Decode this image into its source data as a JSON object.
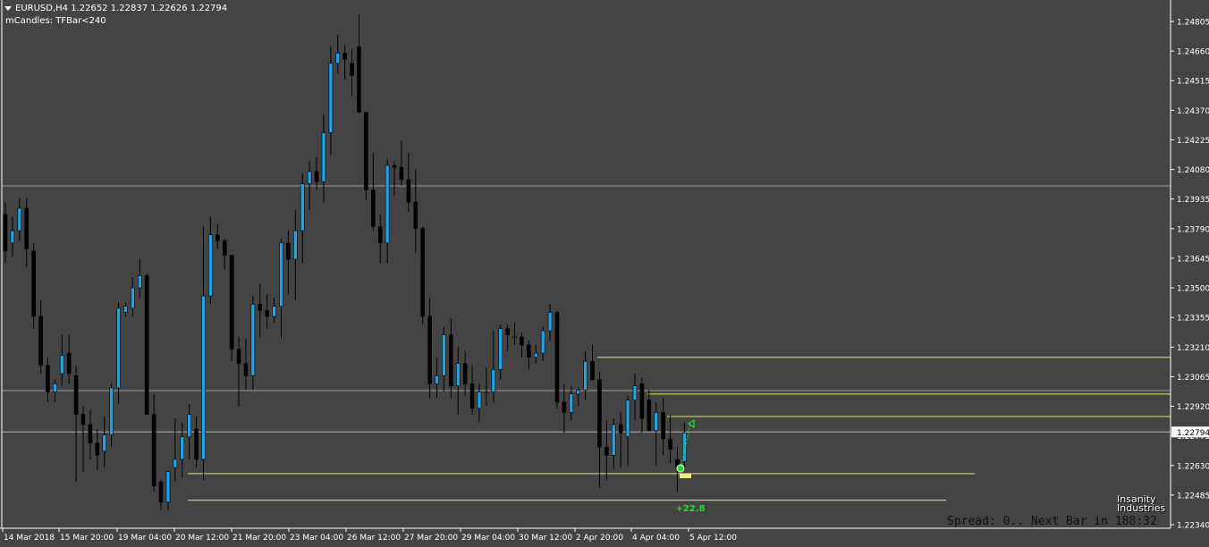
{
  "header": {
    "symbol_line": "EURUSD,H4  1.22652 1.22837 1.22626 1.22794",
    "indicator_line": "mCandles: TFBar<240"
  },
  "price_axis": {
    "labels": [
      "1.24805",
      "1.24660",
      "1.24515",
      "1.24370",
      "1.24225",
      "1.24080",
      "1.23935",
      "1.23790",
      "1.23645",
      "1.23500",
      "1.23355",
      "1.23210",
      "1.23065",
      "1.22920",
      "1.22775",
      "1.22630",
      "1.22485",
      "1.22340"
    ],
    "current_price": "1.22794"
  },
  "time_axis": {
    "labels": [
      "14 Mar 2018",
      "15 Mar 20:00",
      "19 Mar 04:00",
      "20 Mar 12:00",
      "21 Mar 20:00",
      "23 Mar 04:00",
      "26 Mar 12:00",
      "27 Mar 20:00",
      "29 Mar 04:00",
      "30 Mar 12:00",
      "2 Apr 20:00",
      "4 Apr 04:00",
      "5 Apr 12:00"
    ]
  },
  "annotation": {
    "pips": "+22.8"
  },
  "status": {
    "text": "Spread: 0.. Next Bar in 188:32"
  },
  "logo": {
    "line1": "Insanity",
    "line2": "Industries"
  },
  "colors": {
    "background": "#444444",
    "bull": "#1fa2e6",
    "bear": "#000000",
    "level_line": "#e8e85a",
    "grid_line": "#9a9a9a",
    "axis_text": "#ffffff",
    "pips_text": "#22dd22"
  },
  "chart_data": {
    "type": "candlestick",
    "symbol": "EURUSD",
    "timeframe": "H4",
    "ylim": [
      1.2231,
      1.2494
    ],
    "candles": [
      [
        1.2386,
        1.2392,
        1.2362,
        1.2368
      ],
      [
        1.2372,
        1.2385,
        1.2365,
        1.2378
      ],
      [
        1.2378,
        1.2394,
        1.2373,
        1.2389
      ],
      [
        1.2389,
        1.2394,
        1.236,
        1.2369
      ],
      [
        1.2368,
        1.2372,
        1.233,
        1.2336
      ],
      [
        1.2336,
        1.2344,
        1.2308,
        1.2312
      ],
      [
        1.2312,
        1.2316,
        1.2294,
        1.2299
      ],
      [
        1.2299,
        1.2305,
        1.2294,
        1.2303
      ],
      [
        1.2308,
        1.2327,
        1.2302,
        1.2317
      ],
      [
        1.2318,
        1.2327,
        1.2303,
        1.2308
      ],
      [
        1.2307,
        1.2312,
        1.2255,
        1.2288
      ],
      [
        1.2288,
        1.2292,
        1.226,
        1.2283
      ],
      [
        1.2283,
        1.229,
        1.2266,
        1.2274
      ],
      [
        1.2274,
        1.2281,
        1.2261,
        1.2268
      ],
      [
        1.227,
        1.2287,
        1.2262,
        1.2278
      ],
      [
        1.2278,
        1.2303,
        1.2272,
        1.2301
      ],
      [
        1.2301,
        1.2343,
        1.2293,
        1.234
      ],
      [
        1.2338,
        1.2343,
        1.2336,
        1.2341
      ],
      [
        1.234,
        1.2355,
        1.2336,
        1.235
      ],
      [
        1.235,
        1.2364,
        1.2345,
        1.2356
      ],
      [
        1.2356,
        1.2357,
        1.2289,
        1.2288
      ],
      [
        1.2288,
        1.2298,
        1.225,
        1.2253
      ],
      [
        1.2255,
        1.2256,
        1.2241,
        1.2245
      ],
      [
        1.2245,
        1.226,
        1.2241,
        1.226
      ],
      [
        1.2262,
        1.2286,
        1.2255,
        1.2266
      ],
      [
        1.2266,
        1.2284,
        1.2257,
        1.2277
      ],
      [
        1.2277,
        1.2293,
        1.2266,
        1.2288
      ],
      [
        1.2281,
        1.2287,
        1.2262,
        1.2266
      ],
      [
        1.2266,
        1.238,
        1.2256,
        1.2346
      ],
      [
        1.2346,
        1.2385,
        1.2342,
        1.2376
      ],
      [
        1.2376,
        1.2381,
        1.2369,
        1.2373
      ],
      [
        1.2373,
        1.2374,
        1.2359,
        1.2366
      ],
      [
        1.2366,
        1.2366,
        1.2314,
        1.232
      ],
      [
        1.232,
        1.2326,
        1.2292,
        1.2313
      ],
      [
        1.2313,
        1.2325,
        1.23,
        1.2307
      ],
      [
        1.2307,
        1.2346,
        1.23,
        1.2342
      ],
      [
        1.2342,
        1.2352,
        1.2326,
        1.2339
      ],
      [
        1.2339,
        1.2347,
        1.233,
        1.2336
      ],
      [
        1.2336,
        1.2345,
        1.2333,
        1.2341
      ],
      [
        1.2341,
        1.2374,
        1.2325,
        1.2372
      ],
      [
        1.2372,
        1.2378,
        1.2347,
        1.2364
      ],
      [
        1.2364,
        1.2388,
        1.2344,
        1.2378
      ],
      [
        1.2378,
        1.2406,
        1.2362,
        1.2401
      ],
      [
        1.2401,
        1.2412,
        1.2388,
        1.2407
      ],
      [
        1.2407,
        1.2414,
        1.2398,
        1.2402
      ],
      [
        1.2402,
        1.2435,
        1.2392,
        1.2426
      ],
      [
        1.2426,
        1.2468,
        1.2415,
        1.246
      ],
      [
        1.246,
        1.2474,
        1.2455,
        1.2465
      ],
      [
        1.2465,
        1.2469,
        1.2452,
        1.2462
      ],
      [
        1.246,
        1.2467,
        1.2444,
        1.2454
      ],
      [
        1.2468,
        1.2484,
        1.2436,
        1.2436
      ],
      [
        1.2436,
        1.2436,
        1.2393,
        1.2398
      ],
      [
        1.2398,
        1.2416,
        1.2378,
        1.238
      ],
      [
        1.238,
        1.2386,
        1.2362,
        1.2372
      ],
      [
        1.2372,
        1.2413,
        1.2362,
        1.241
      ],
      [
        1.241,
        1.2412,
        1.2395,
        1.2409
      ],
      [
        1.2409,
        1.2422,
        1.24,
        1.2403
      ],
      [
        1.2403,
        1.2416,
        1.2387,
        1.2392
      ],
      [
        1.2392,
        1.2408,
        1.2367,
        1.2379
      ],
      [
        1.2379,
        1.238,
        1.2332,
        1.2336
      ],
      [
        1.2336,
        1.2345,
        1.2296,
        1.2303
      ],
      [
        1.2303,
        1.2316,
        1.2296,
        1.2307
      ],
      [
        1.2307,
        1.2331,
        1.2299,
        1.2327
      ],
      [
        1.2327,
        1.2335,
        1.2296,
        1.2302
      ],
      [
        1.2302,
        1.2321,
        1.2288,
        1.2313
      ],
      [
        1.2313,
        1.2319,
        1.2297,
        1.2303
      ],
      [
        1.2303,
        1.2312,
        1.2288,
        1.2291
      ],
      [
        1.2291,
        1.2303,
        1.2284,
        1.2299
      ],
      [
        1.2299,
        1.2311,
        1.2292,
        1.2299
      ],
      [
        1.2299,
        1.2329,
        1.2294,
        1.231
      ],
      [
        1.231,
        1.2332,
        1.2305,
        1.233
      ],
      [
        1.233,
        1.2332,
        1.2319,
        1.2327
      ],
      [
        1.2326,
        1.2333,
        1.2322,
        1.2326
      ],
      [
        1.2326,
        1.2328,
        1.2316,
        1.2322
      ],
      [
        1.2322,
        1.2324,
        1.231,
        1.2316
      ],
      [
        1.2316,
        1.2322,
        1.2313,
        1.2318
      ],
      [
        1.2318,
        1.2331,
        1.2314,
        1.2329
      ],
      [
        1.2329,
        1.2342,
        1.2324,
        1.2338
      ],
      [
        1.2338,
        1.2339,
        1.2291,
        1.2294
      ],
      [
        1.2294,
        1.2303,
        1.2279,
        1.2289
      ],
      [
        1.2289,
        1.2302,
        1.2285,
        1.2298
      ],
      [
        1.2298,
        1.2301,
        1.2292,
        1.23
      ],
      [
        1.23,
        1.2319,
        1.2295,
        1.2314
      ],
      [
        1.2314,
        1.2322,
        1.2305,
        1.2305
      ],
      [
        1.2305,
        1.2309,
        1.2252,
        1.2272
      ],
      [
        1.2272,
        1.2285,
        1.2256,
        1.2268
      ],
      [
        1.2268,
        1.2286,
        1.2261,
        1.2283
      ],
      [
        1.2283,
        1.2289,
        1.2262,
        1.2279
      ],
      [
        1.2277,
        1.2297,
        1.2263,
        1.2295
      ],
      [
        1.2295,
        1.2308,
        1.2285,
        1.2302
      ],
      [
        1.2303,
        1.2306,
        1.2279,
        1.2286
      ],
      [
        1.2295,
        1.23,
        1.2282,
        1.228
      ],
      [
        1.228,
        1.2294,
        1.2263,
        1.2289
      ],
      [
        1.2289,
        1.2296,
        1.2268,
        1.2276
      ],
      [
        1.2276,
        1.2288,
        1.2264,
        1.2271
      ],
      [
        1.2266,
        1.2272,
        1.225,
        1.2262
      ],
      [
        1.2265,
        1.2284,
        1.2261,
        1.2279
      ]
    ],
    "horizontal_levels": [
      1.2316,
      1.2298,
      1.2287,
      1.2259,
      1.2246
    ]
  }
}
